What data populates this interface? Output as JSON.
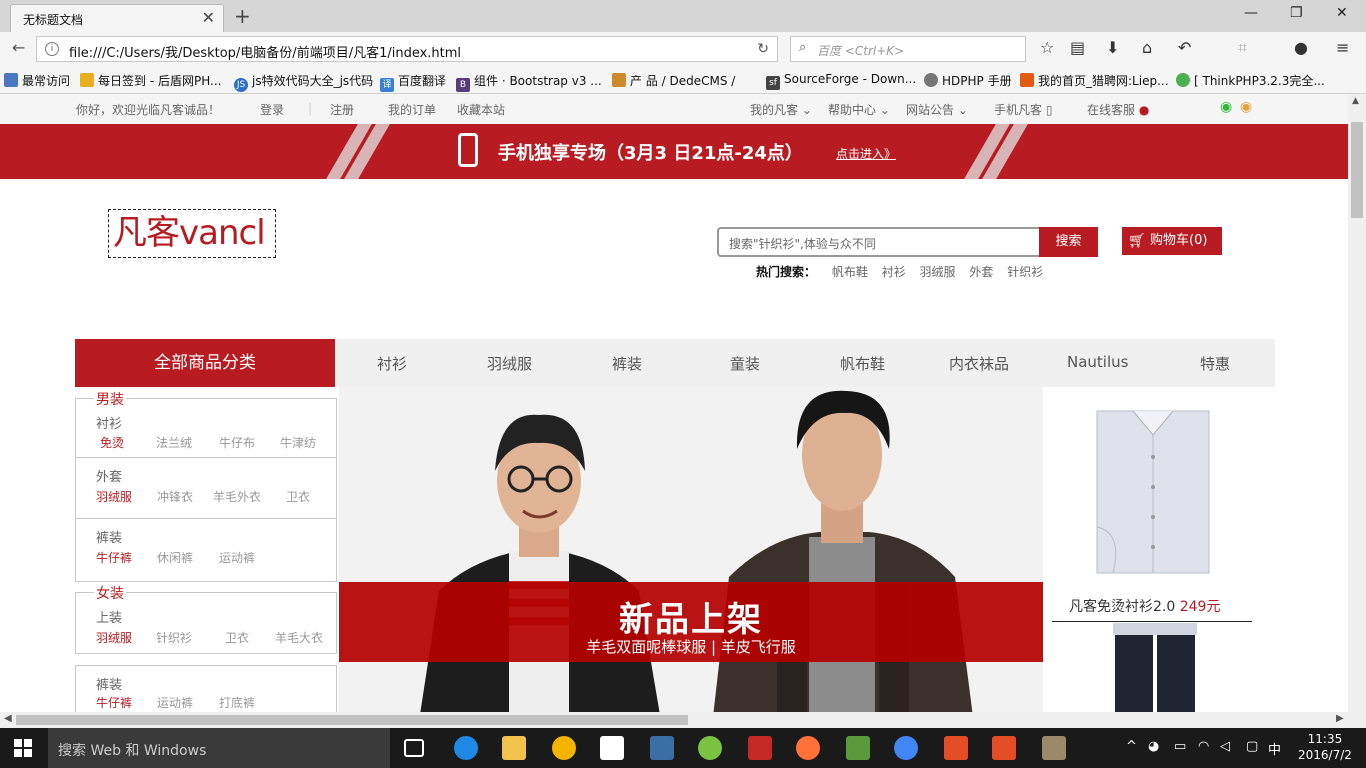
{
  "browser": {
    "tab_title": "无标题文档",
    "url": "file:///C:/Users/我/Desktop/电脑备份/前端项目/凡客1/index.html",
    "search_placeholder": "百度 <Ctrl+K>",
    "bookmarks": [
      "最常访问",
      "每日签到 - 后盾网PH...",
      "js特效代码大全_js代码",
      "百度翻译",
      "组件 · Bootstrap v3 ...",
      "产 品 / DedeCMS /",
      "SourceForge - Down...",
      "HDPHP 手册",
      "我的首页_猎聘网:Liep...",
      "[ ThinkPHP3.2.3完全..."
    ]
  },
  "topnav": {
    "welcome": "你好，欢迎光临凡客诚品！",
    "login": "登录",
    "register": "注册",
    "orders": "我的订单",
    "favorite": "收藏本站",
    "my_vancl": "我的凡客",
    "help": "帮助中心",
    "notice": "网站公告",
    "mobile": "手机凡客",
    "service": "在线客服"
  },
  "promo": {
    "text": "手机独享专场（3月3 日21点-24点）",
    "link": "点击进入》"
  },
  "logo": "凡客vancl",
  "search": {
    "placeholder": "搜索\"针织衫\",体验与众不同",
    "button": "搜索",
    "hot_label": "热门搜索：",
    "hot_items": [
      "帆布鞋",
      "衬衫",
      "羽绒服",
      "外套",
      "针织衫"
    ]
  },
  "cart": "购物车(0)",
  "category": {
    "all": "全部商品分类",
    "items": [
      "衬衫",
      "羽绒服",
      "裤装",
      "童装",
      "帆布鞋",
      "内衣袜品",
      "Nautilus",
      "特惠"
    ]
  },
  "sidebar": {
    "men": {
      "title": "男装",
      "groups": [
        {
          "head": "衬衫",
          "items": [
            "免烫",
            "法兰绒",
            "牛仔布",
            "牛津纺"
          ]
        },
        {
          "head": "外套",
          "items": [
            "羽绒服",
            "冲锋衣",
            "羊毛外衣",
            "卫衣"
          ]
        },
        {
          "head": "裤装",
          "items": [
            "牛仔裤",
            "休闲裤",
            "运动裤"
          ]
        }
      ]
    },
    "women": {
      "title": "女装",
      "groups": [
        {
          "head": "上装",
          "items": [
            "羽绒服",
            "针织衫",
            "卫衣",
            "羊毛大衣"
          ]
        },
        {
          "head": "裤装",
          "items": [
            "牛仔裤",
            "运动裤",
            "打底裤"
          ]
        }
      ]
    }
  },
  "banner": {
    "title": "新品上架",
    "subtitle": "羊毛双面呢棒球服 | 羊皮飞行服"
  },
  "right_ad": {
    "caption": "凡客免烫衬衫2.0",
    "price": "249元"
  },
  "taskbar": {
    "search": "搜索 Web 和 Windows",
    "time": "11:35",
    "date": "2016/7/2",
    "ime": "中"
  },
  "colors": {
    "brand": "#b81c22"
  }
}
